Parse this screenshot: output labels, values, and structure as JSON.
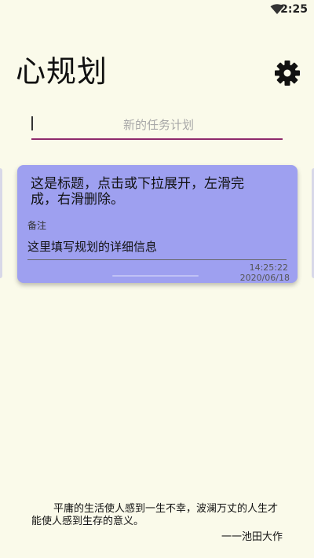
{
  "status_bar": {
    "time": "2:25",
    "wifi_icon": "wifi-icon"
  },
  "app": {
    "title": "心规划",
    "settings_icon": "gear-icon"
  },
  "task_input": {
    "placeholder": "新的任务计划",
    "value": ""
  },
  "card": {
    "title": "这是标题，点击或下拉展开，左滑完成，右滑删除。",
    "note_label": "备注",
    "note_text": "这里填写规划的详细信息",
    "time": "14:25:22",
    "date": "2020/06/18",
    "background": "#9ea0f0"
  },
  "quote": {
    "text": "平庸的生活使人感到一生不幸，波澜万丈的人生才能使人感到生存的意义。",
    "author": "一一池田大作"
  },
  "colors": {
    "background": "#fafaea",
    "accent": "#8e2a6c"
  }
}
